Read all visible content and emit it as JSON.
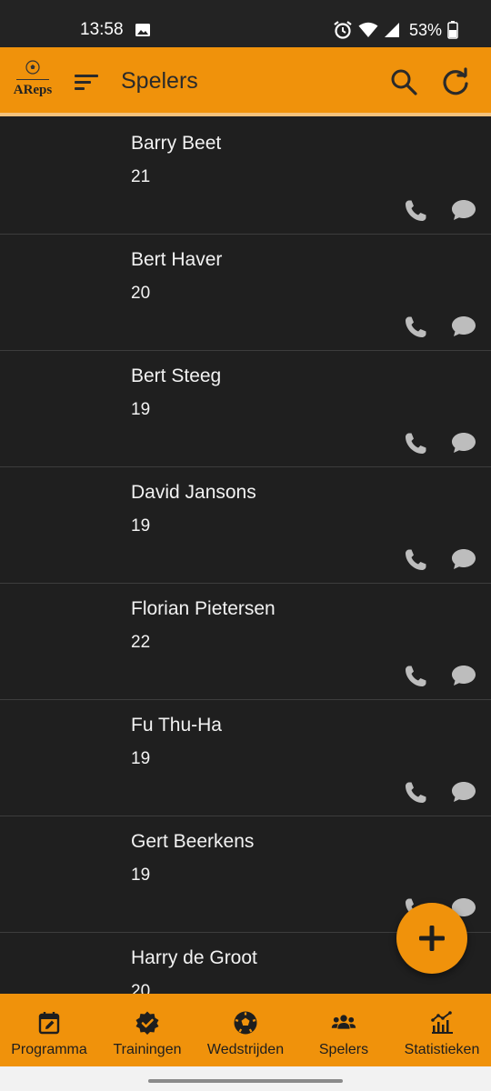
{
  "status_bar": {
    "time": "13:58",
    "battery": "53%",
    "icons": [
      "image-icon",
      "alarm-icon",
      "wifi-icon",
      "signal-icon",
      "battery-icon"
    ]
  },
  "app_bar": {
    "logo_text": "AReps",
    "title": "Spelers",
    "icons": [
      "menu-icon",
      "search-icon",
      "refresh-icon"
    ]
  },
  "players": [
    {
      "name": "Barry Beet",
      "age": "21"
    },
    {
      "name": "Bert Haver",
      "age": "20"
    },
    {
      "name": "Bert Steeg",
      "age": "19"
    },
    {
      "name": "David Jansons",
      "age": "19"
    },
    {
      "name": "Florian Pietersen",
      "age": "22"
    },
    {
      "name": "Fu Thu-Ha",
      "age": "19"
    },
    {
      "name": "Gert Beerkens",
      "age": "19"
    },
    {
      "name": "Harry de Groot",
      "age": "20"
    }
  ],
  "bottom_nav": {
    "items": [
      {
        "label": "Programma",
        "icon": "calendar-edit-icon"
      },
      {
        "label": "Trainingen",
        "icon": "badge-check-icon"
      },
      {
        "label": "Wedstrijden",
        "icon": "soccer-ball-icon"
      },
      {
        "label": "Spelers",
        "icon": "group-icon"
      },
      {
        "label": "Statistieken",
        "icon": "chart-icon"
      }
    ]
  },
  "colors": {
    "accent": "#f0920b",
    "background": "#1f1f1f",
    "text": "#f2f2f2",
    "icon_gray": "#bdbdbd"
  }
}
